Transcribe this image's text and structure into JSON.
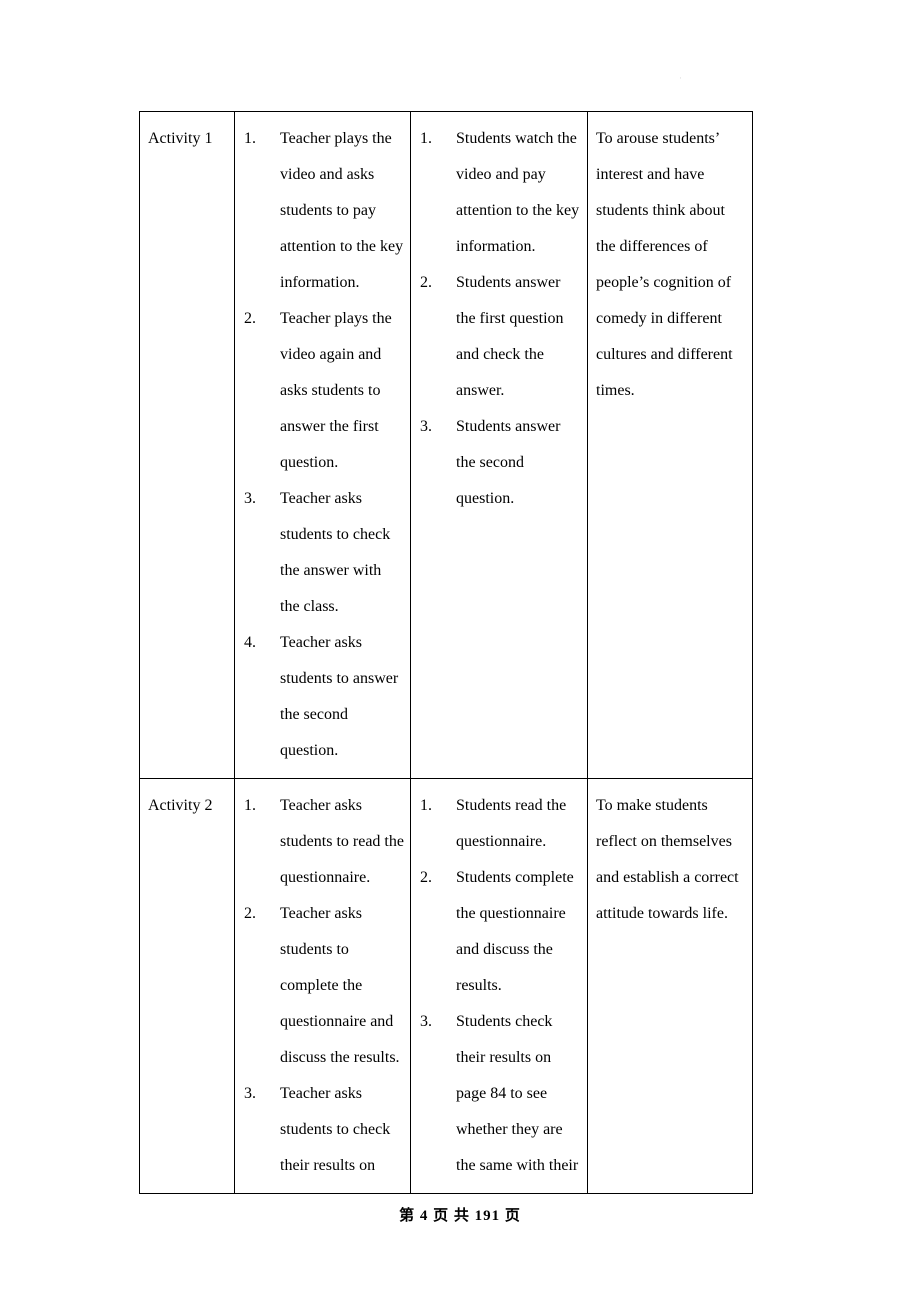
{
  "document": {
    "type": "lesson-plan-table",
    "stray_mark": "·"
  },
  "table": {
    "rows": [
      {
        "activity_label": "Activity 1",
        "teacher_steps": [
          "Teacher plays the video and asks students to pay attention to the key information.",
          "Teacher plays the video again and asks students to answer the first question.",
          "Teacher asks students to check the answer with the class.",
          "Teacher asks students to answer the second question."
        ],
        "student_steps": [
          "Students watch the video and pay attention to the key information.",
          "Students answer the first question and check the answer.",
          "Students answer the second question."
        ],
        "purpose": "To arouse students’ interest and have students think about the differences of people’s cognition of comedy in different cultures and different times."
      },
      {
        "activity_label": "Activity 2",
        "teacher_steps": [
          "Teacher asks students to read the questionnaire.",
          "Teacher asks students to complete the questionnaire and discuss the results.",
          "Teacher asks students to check their results on"
        ],
        "student_steps": [
          "Students read the questionnaire.",
          "Students complete the questionnaire and discuss the results.",
          "Students check their results on page 84 to see whether they are the same with their"
        ],
        "purpose": "To make students reflect on themselves and establish a correct attitude towards life."
      }
    ],
    "markers": [
      "1.",
      "2.",
      "3.",
      "4."
    ]
  },
  "footer": {
    "text": "第 4 页 共 191 页",
    "page_number": "4",
    "total_pages": "191"
  }
}
